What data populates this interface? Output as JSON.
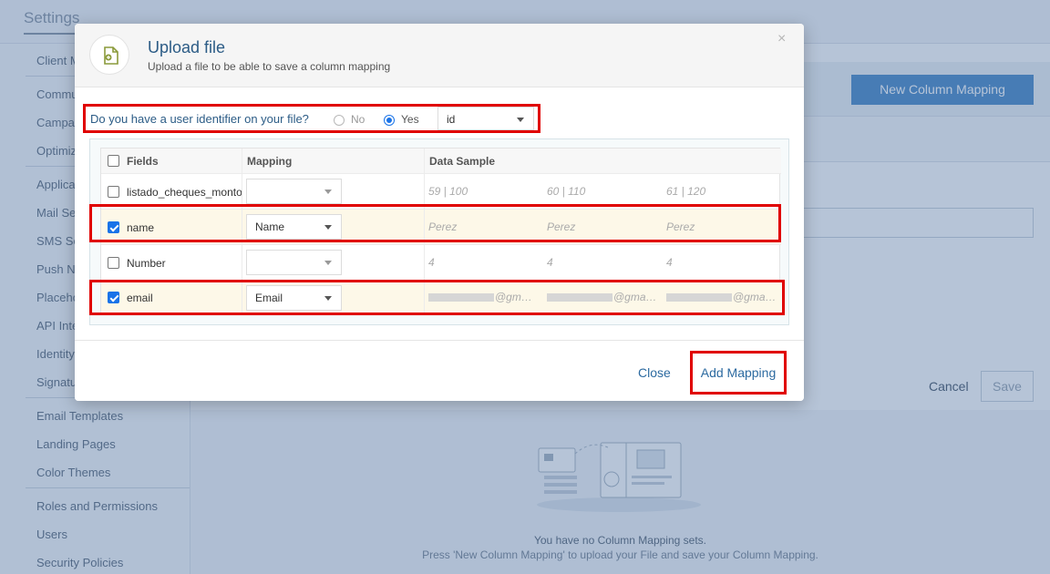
{
  "page": {
    "title": "Settings"
  },
  "sidebar": {
    "items": [
      "Client M",
      "Commu",
      "Campa",
      "Optimiz",
      "Applica",
      "Mail Se",
      "SMS Se",
      "Push N",
      "Placeho",
      "API Inte",
      "Identity",
      "Signatu",
      "Email Templates",
      "Landing Pages",
      "Color Themes",
      "Roles and Permissions",
      "Users",
      "Security Policies"
    ]
  },
  "main": {
    "new_mapping_button": "New Column Mapping",
    "cancel_label": "Cancel",
    "save_label": "Save",
    "empty_title": "You have no Column Mapping sets.",
    "empty_hint": "Press 'New Column Mapping' to upload your File and save your Column Mapping."
  },
  "modal": {
    "title": "Upload file",
    "subtitle": "Upload a file to be able to save a column mapping",
    "close_icon": "×",
    "identifier_question": "Do you have a user identifier on your file?",
    "radio_no": "No",
    "radio_yes": "Yes",
    "radio_selected": "Yes",
    "identifier_value": "id",
    "table": {
      "headers": {
        "fields": "Fields",
        "mapping": "Mapping",
        "data_sample": "Data Sample"
      },
      "rows": [
        {
          "field": "listado_cheques_monto",
          "checked": false,
          "mapping": "",
          "samples": [
            "59 | 100",
            "60 | 110",
            "61 | 120"
          ]
        },
        {
          "field": "name",
          "checked": true,
          "mapping": "Name",
          "samples": [
            "Perez",
            "Perez",
            "Perez"
          ]
        },
        {
          "field": "Number",
          "checked": false,
          "mapping": "",
          "samples": [
            "4",
            "4",
            "4"
          ]
        },
        {
          "field": "email",
          "checked": true,
          "mapping": "Email",
          "samples": [
            "@gm…",
            "@gma…",
            "@gma…"
          ]
        }
      ]
    },
    "footer": {
      "close_label": "Close",
      "add_label": "Add Mapping"
    }
  },
  "colors": {
    "accent": "#2c5c86",
    "primary_button": "#4c8bc9",
    "highlight_red": "#e00000",
    "checkbox_blue": "#1a73e8",
    "row_highlight": "#fdf8e8"
  }
}
